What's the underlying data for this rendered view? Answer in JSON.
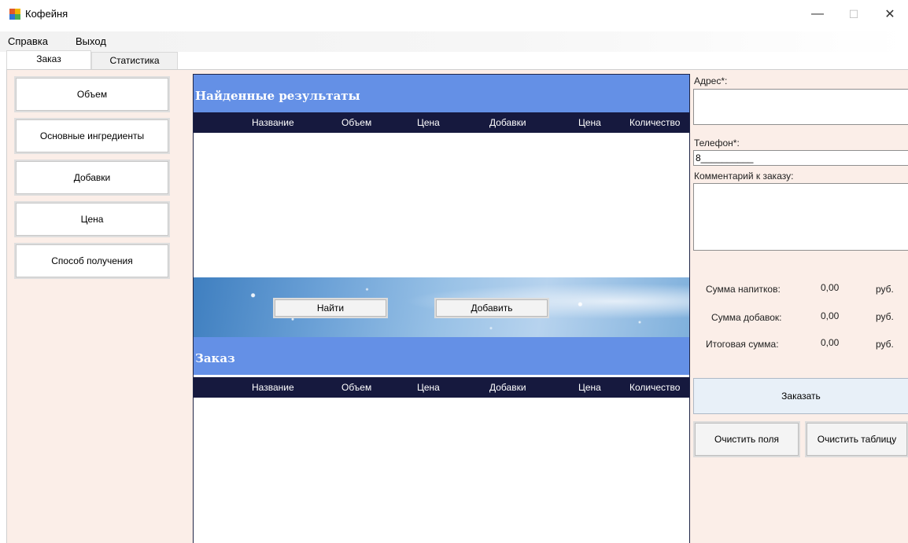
{
  "window": {
    "title": "Кофейня",
    "controls": {
      "minimize": "—",
      "maximize": "☐",
      "close": "✕"
    }
  },
  "menu": [
    "Справка",
    "Выход"
  ],
  "tabs": [
    {
      "label": "Заказ",
      "active": true
    },
    {
      "label": "Статистика",
      "active": false
    }
  ],
  "left_buttons": [
    "Объем",
    "Основные ингредиенты",
    "Добавки",
    "Цена",
    "Способ получения"
  ],
  "results": {
    "title": "Найденные результаты",
    "columns": [
      "Название",
      "Объем",
      "Цена",
      "Добавки",
      "Цена",
      "Количество"
    ]
  },
  "actions": {
    "find": "Найти",
    "add": "Добавить"
  },
  "order": {
    "title": "Заказ",
    "columns": [
      "Название",
      "Объем",
      "Цена",
      "Добавки",
      "Цена",
      "Количество"
    ]
  },
  "form": {
    "address_label": "Адрес*:",
    "address_value": "",
    "phone_label": "Телефон*:",
    "phone_value": "8__________",
    "comment_label": "Комментарий к заказу:",
    "comment_value": ""
  },
  "totals": [
    {
      "label": "Сумма напитков:",
      "value": "0,00",
      "unit": "руб."
    },
    {
      "label": "Сумма добавок:",
      "value": "0,00",
      "unit": "руб."
    },
    {
      "label": "Итоговая сумма:",
      "value": "0,00",
      "unit": "руб."
    }
  ],
  "buttons": {
    "order": "Заказать",
    "clear_fields": "Очистить поля",
    "clear_table": "Очистить таблицу"
  },
  "colors": {
    "header_blue": "#6490e6",
    "grid_header": "#16193e",
    "panel_bg": "#fbeee8"
  }
}
